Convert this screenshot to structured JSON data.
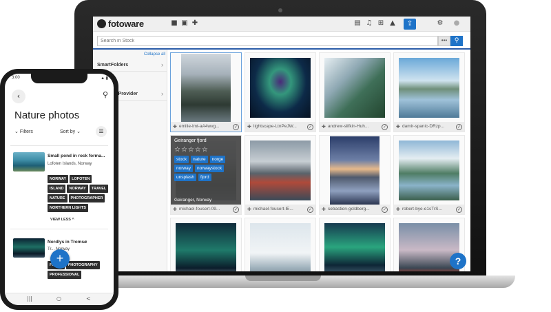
{
  "laptop": {
    "app": {
      "logo": "fotoware"
    },
    "toolbar_icons": [
      "folder-icon",
      "briefcase-icon",
      "pin-icon",
      "book-icon",
      "bell-icon",
      "cart-icon",
      "graduation-cap-icon",
      "upload-icon",
      "gear-icon",
      "user-icon"
    ],
    "search": {
      "placeholder": "Search in Stock",
      "dots": "•••"
    },
    "sidebar": {
      "collapse_all": "Collapse all",
      "items": [
        {
          "label": "SmartFolders"
        },
        {
          "label": "to Provider"
        }
      ]
    },
    "grid": {
      "tiles": [
        {
          "caption": "emilie-lmt-aA4wvg...",
          "image": "fjord",
          "selected": true
        },
        {
          "caption": "lightscape-LtnPeJW...",
          "image": "aurora"
        },
        {
          "caption": "andrew-slifkin-Huh...",
          "image": "alps"
        },
        {
          "caption": "damir-spanic-DRzp...",
          "image": "lake"
        },
        {
          "caption": "michael-fousert-09...",
          "image": "fjord"
        },
        {
          "caption": "michael-fousert-lE...",
          "image": "harbor"
        },
        {
          "caption": "sebastien-goldberg...",
          "image": "sunset"
        },
        {
          "caption": "robert-bye-e1sTrS...",
          "image": "mtn"
        },
        {
          "caption": "",
          "image": "aurora2"
        },
        {
          "caption": "",
          "image": "snow"
        },
        {
          "caption": "",
          "image": "aurora3"
        },
        {
          "caption": "",
          "image": "dusk"
        }
      ],
      "hover_overlay": {
        "title": "Geiranger fjord",
        "stars": "☆☆☆☆☆",
        "tags": [
          "stock",
          "nature",
          "norge",
          "norway",
          "norwaystock",
          "unsplash",
          "fjord"
        ],
        "location": "Geiranger, Norway"
      }
    },
    "help_label": "?"
  },
  "phone": {
    "status_time": "3:00",
    "status_icons": "▲ ▮",
    "title": "Nature photos",
    "filters_label": "Filters",
    "sort_label": "Sort by",
    "cards": [
      {
        "title": "Small pond in rock forma...",
        "location": "Lofoten Islands, Norway",
        "tags": [
          "NORWAY",
          "LOFOTEN",
          "ISLAND",
          "NORWAY",
          "TRAVEL",
          "NATURE",
          "PHOTOGRAPHER",
          "NORTHERN LIGHTS"
        ],
        "view_less": "VIEW LESS"
      },
      {
        "title": "Nordlys in Tromsø",
        "location": "Tr... Norway",
        "tags": [
          "FJORD",
          "PHOTOGRAPHY",
          "PROFESSIONAL"
        ]
      }
    ],
    "fab": "+",
    "nav": [
      "|||",
      "○",
      "<"
    ]
  }
}
